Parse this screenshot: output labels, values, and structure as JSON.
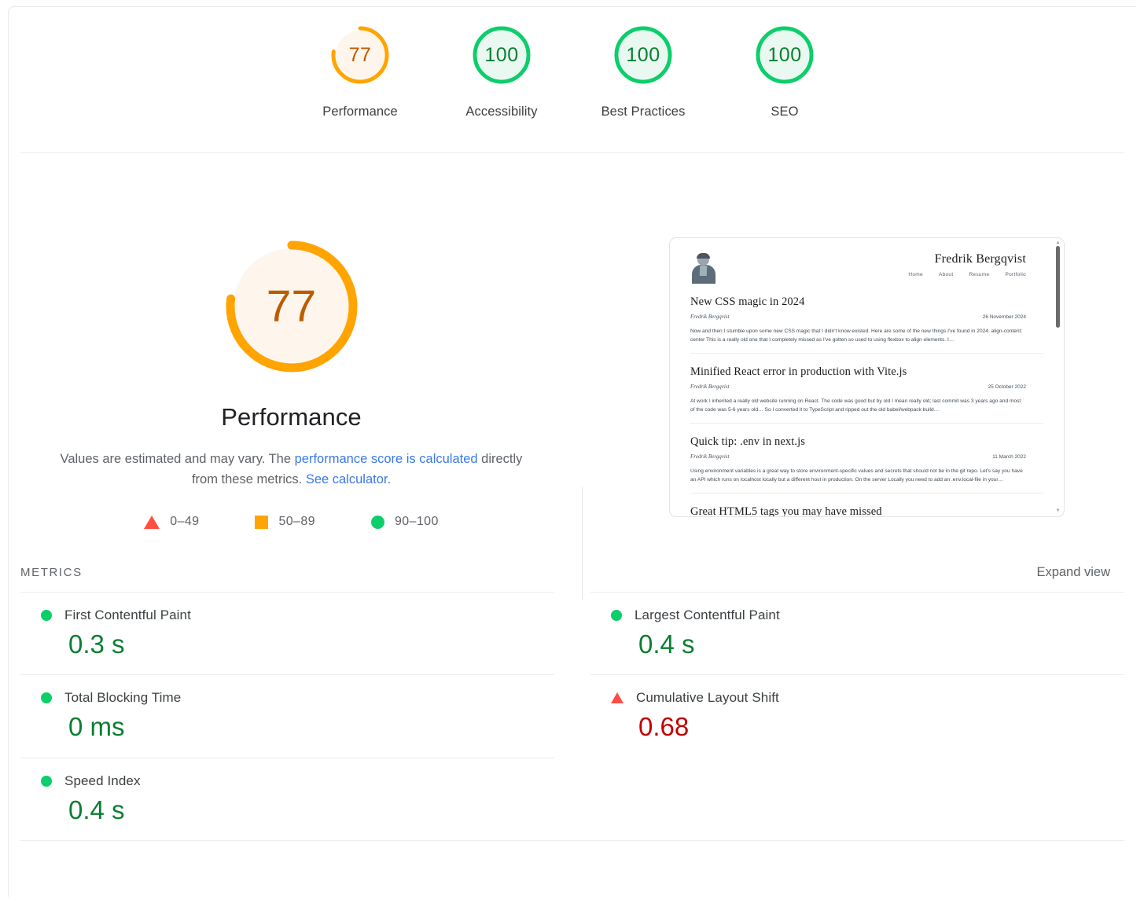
{
  "scores": [
    {
      "value": "77",
      "label": "Performance",
      "pct": 77,
      "state": "average"
    },
    {
      "value": "100",
      "label": "Accessibility",
      "pct": 100,
      "state": "pass"
    },
    {
      "value": "100",
      "label": "Best Practices",
      "pct": 100,
      "state": "pass"
    },
    {
      "value": "100",
      "label": "SEO",
      "pct": 100,
      "state": "pass"
    }
  ],
  "performance": {
    "score": "77",
    "pct": 77,
    "title": "Performance",
    "desc_part1": "Values are estimated and may vary. The ",
    "link1": "performance score is calculated",
    "desc_part2": " directly from these metrics. ",
    "link2": "See calculator.",
    "legend": [
      {
        "icon": "triangle-icon",
        "range": "0–49"
      },
      {
        "icon": "square-icon",
        "range": "50–89"
      },
      {
        "icon": "circle-icon",
        "range": "90–100"
      }
    ]
  },
  "thumbnail": {
    "site_name": "Fredrik Bergqvist",
    "nav": [
      "Home",
      "About",
      "Resume",
      "Portfolio"
    ],
    "posts": [
      {
        "title": "New CSS magic in 2024",
        "author": "Fredrik Bergqvist",
        "date": "26 November 2024",
        "excerpt": "Now and then I stumble upon some new CSS magic that I didn't know existed. Here are some of the new things I've found in 2024. align-content: center This is a really old one that I completely missed as I've gotten so used to using flexbox to align elements. I…"
      },
      {
        "title": "Minified React error in production with Vite.js",
        "author": "Fredrik Bergqvist",
        "date": "25 October 2022",
        "excerpt": "At work I inherited a really old website running on React. The code was good but by old I mean really old; last commit was 3 years ago and most of the code was 5-6 years old… So I converted it to TypeScript and ripped out the old babel/webpack build…"
      },
      {
        "title": "Quick tip: .env in next.js",
        "author": "Fredrik Bergqvist",
        "date": "11 March 2022",
        "excerpt": "Using environment variables is a great way to store environment-specific values and secrets that should not be in the git repo. Let's say you have an API which runs on localhost locally but a different host in production. On the server Locally you need to add an .env.local-file in your…"
      },
      {
        "title": "Great HTML5 tags you may have missed",
        "author": "",
        "date": "",
        "excerpt": ""
      }
    ]
  },
  "metrics_section": {
    "heading": "METRICS",
    "expand_view": "Expand view",
    "left": [
      {
        "icon": "circle-icon",
        "state": "pass",
        "name": "First Contentful Paint",
        "value": "0.3 s"
      },
      {
        "icon": "circle-icon",
        "state": "pass",
        "name": "Total Blocking Time",
        "value": "0 ms"
      },
      {
        "icon": "circle-icon",
        "state": "pass",
        "name": "Speed Index",
        "value": "0.4 s"
      }
    ],
    "right": [
      {
        "icon": "circle-icon",
        "state": "pass",
        "name": "Largest Contentful Paint",
        "value": "0.4 s"
      },
      {
        "icon": "triangle-icon",
        "state": "fail",
        "name": "Cumulative Layout Shift",
        "value": "0.68"
      }
    ]
  },
  "colors": {
    "pass": "#0cce6b",
    "average": "#ffa400",
    "fail": "#ff4e42",
    "pass_text": "#0a7e32",
    "average_text": "#bd5b00",
    "fail_text": "#c00000",
    "link": "#3b78e7"
  }
}
